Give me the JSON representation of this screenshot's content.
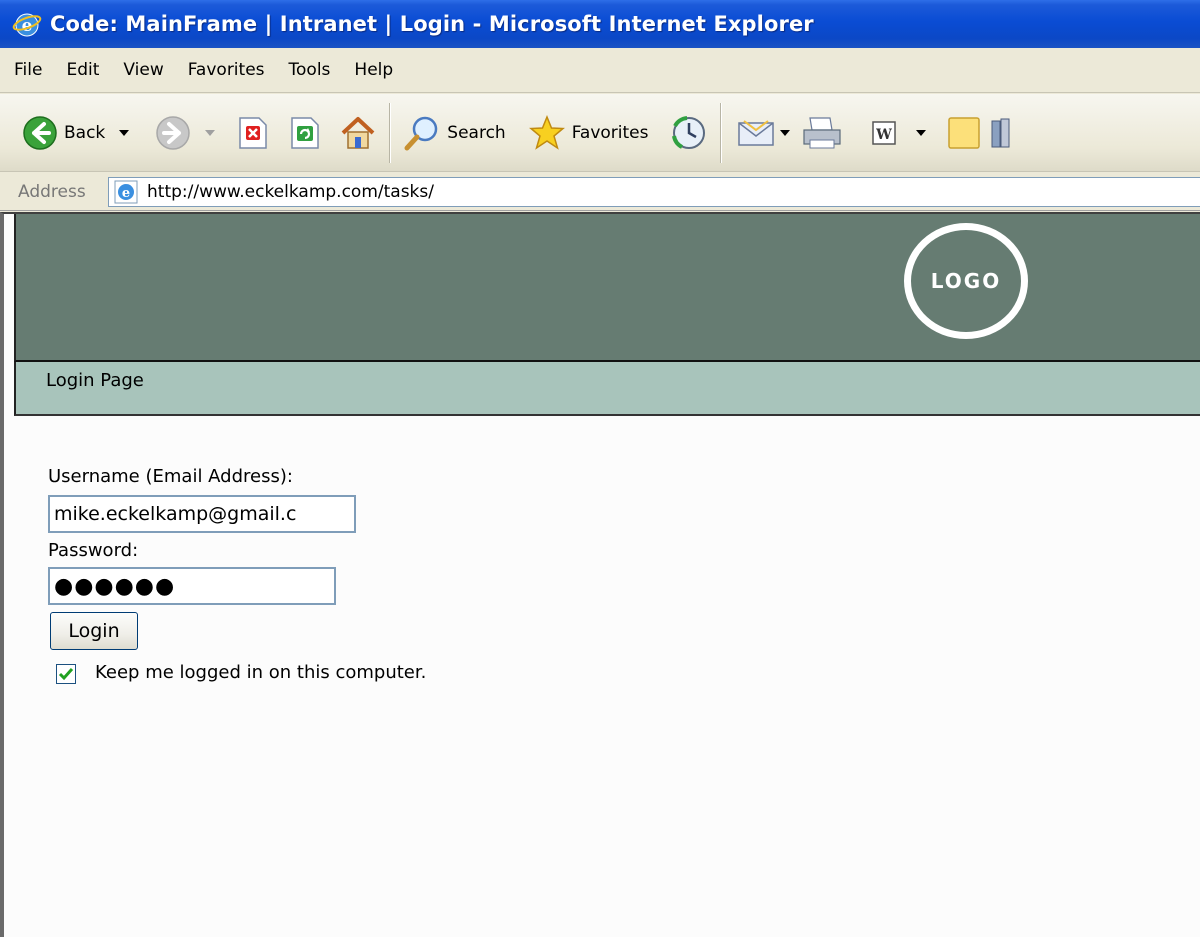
{
  "window": {
    "title": "Code: MainFrame | Intranet | Login - Microsoft Internet Explorer"
  },
  "menu": [
    "File",
    "Edit",
    "View",
    "Favorites",
    "Tools",
    "Help"
  ],
  "toolbar": {
    "back_label": "Back",
    "search_label": "Search",
    "favorites_label": "Favorites"
  },
  "address": {
    "label": "Address",
    "url": "http://www.eckelkamp.com/tasks/"
  },
  "page": {
    "logo_text": "LOGO",
    "section_title": "Login Page",
    "username_label": "Username (Email Address):",
    "username_value": "mike.eckelkamp@gmail.c",
    "password_label": "Password:",
    "password_value": "●●●●●●",
    "login_button": "Login",
    "keep_logged_in_label": "Keep me logged in on this computer.",
    "keep_logged_in_checked": true
  },
  "colors": {
    "banner": "#667c72",
    "subbanner": "#a8c4bb",
    "titlebar": "#0a4cd4"
  }
}
